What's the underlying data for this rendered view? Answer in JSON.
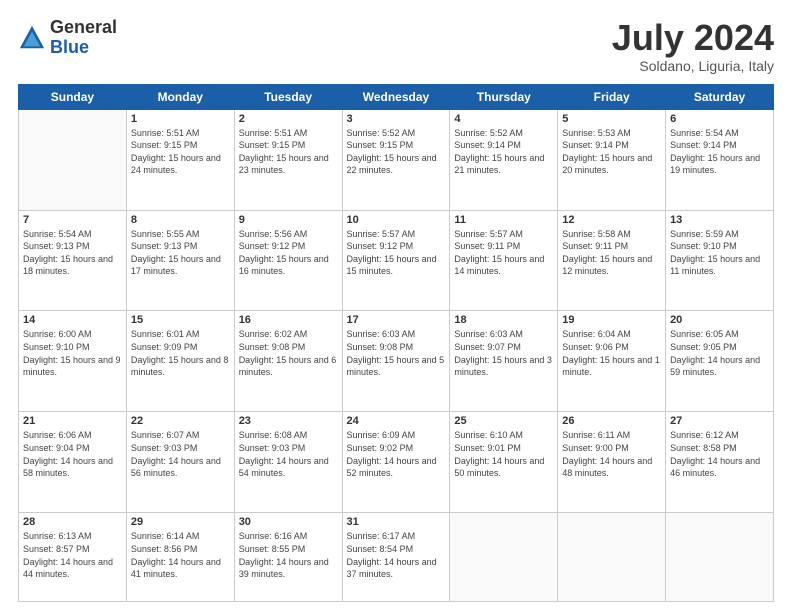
{
  "header": {
    "logo": {
      "general": "General",
      "blue": "Blue"
    },
    "title": "July 2024",
    "subtitle": "Soldano, Liguria, Italy"
  },
  "weekdays": [
    "Sunday",
    "Monday",
    "Tuesday",
    "Wednesday",
    "Thursday",
    "Friday",
    "Saturday"
  ],
  "weeks": [
    [
      {
        "day": null
      },
      {
        "day": 1,
        "sunrise": "Sunrise: 5:51 AM",
        "sunset": "Sunset: 9:15 PM",
        "daylight": "Daylight: 15 hours and 24 minutes."
      },
      {
        "day": 2,
        "sunrise": "Sunrise: 5:51 AM",
        "sunset": "Sunset: 9:15 PM",
        "daylight": "Daylight: 15 hours and 23 minutes."
      },
      {
        "day": 3,
        "sunrise": "Sunrise: 5:52 AM",
        "sunset": "Sunset: 9:15 PM",
        "daylight": "Daylight: 15 hours and 22 minutes."
      },
      {
        "day": 4,
        "sunrise": "Sunrise: 5:52 AM",
        "sunset": "Sunset: 9:14 PM",
        "daylight": "Daylight: 15 hours and 21 minutes."
      },
      {
        "day": 5,
        "sunrise": "Sunrise: 5:53 AM",
        "sunset": "Sunset: 9:14 PM",
        "daylight": "Daylight: 15 hours and 20 minutes."
      },
      {
        "day": 6,
        "sunrise": "Sunrise: 5:54 AM",
        "sunset": "Sunset: 9:14 PM",
        "daylight": "Daylight: 15 hours and 19 minutes."
      }
    ],
    [
      {
        "day": 7,
        "sunrise": "Sunrise: 5:54 AM",
        "sunset": "Sunset: 9:13 PM",
        "daylight": "Daylight: 15 hours and 18 minutes."
      },
      {
        "day": 8,
        "sunrise": "Sunrise: 5:55 AM",
        "sunset": "Sunset: 9:13 PM",
        "daylight": "Daylight: 15 hours and 17 minutes."
      },
      {
        "day": 9,
        "sunrise": "Sunrise: 5:56 AM",
        "sunset": "Sunset: 9:12 PM",
        "daylight": "Daylight: 15 hours and 16 minutes."
      },
      {
        "day": 10,
        "sunrise": "Sunrise: 5:57 AM",
        "sunset": "Sunset: 9:12 PM",
        "daylight": "Daylight: 15 hours and 15 minutes."
      },
      {
        "day": 11,
        "sunrise": "Sunrise: 5:57 AM",
        "sunset": "Sunset: 9:11 PM",
        "daylight": "Daylight: 15 hours and 14 minutes."
      },
      {
        "day": 12,
        "sunrise": "Sunrise: 5:58 AM",
        "sunset": "Sunset: 9:11 PM",
        "daylight": "Daylight: 15 hours and 12 minutes."
      },
      {
        "day": 13,
        "sunrise": "Sunrise: 5:59 AM",
        "sunset": "Sunset: 9:10 PM",
        "daylight": "Daylight: 15 hours and 11 minutes."
      }
    ],
    [
      {
        "day": 14,
        "sunrise": "Sunrise: 6:00 AM",
        "sunset": "Sunset: 9:10 PM",
        "daylight": "Daylight: 15 hours and 9 minutes."
      },
      {
        "day": 15,
        "sunrise": "Sunrise: 6:01 AM",
        "sunset": "Sunset: 9:09 PM",
        "daylight": "Daylight: 15 hours and 8 minutes."
      },
      {
        "day": 16,
        "sunrise": "Sunrise: 6:02 AM",
        "sunset": "Sunset: 9:08 PM",
        "daylight": "Daylight: 15 hours and 6 minutes."
      },
      {
        "day": 17,
        "sunrise": "Sunrise: 6:03 AM",
        "sunset": "Sunset: 9:08 PM",
        "daylight": "Daylight: 15 hours and 5 minutes."
      },
      {
        "day": 18,
        "sunrise": "Sunrise: 6:03 AM",
        "sunset": "Sunset: 9:07 PM",
        "daylight": "Daylight: 15 hours and 3 minutes."
      },
      {
        "day": 19,
        "sunrise": "Sunrise: 6:04 AM",
        "sunset": "Sunset: 9:06 PM",
        "daylight": "Daylight: 15 hours and 1 minute."
      },
      {
        "day": 20,
        "sunrise": "Sunrise: 6:05 AM",
        "sunset": "Sunset: 9:05 PM",
        "daylight": "Daylight: 14 hours and 59 minutes."
      }
    ],
    [
      {
        "day": 21,
        "sunrise": "Sunrise: 6:06 AM",
        "sunset": "Sunset: 9:04 PM",
        "daylight": "Daylight: 14 hours and 58 minutes."
      },
      {
        "day": 22,
        "sunrise": "Sunrise: 6:07 AM",
        "sunset": "Sunset: 9:03 PM",
        "daylight": "Daylight: 14 hours and 56 minutes."
      },
      {
        "day": 23,
        "sunrise": "Sunrise: 6:08 AM",
        "sunset": "Sunset: 9:03 PM",
        "daylight": "Daylight: 14 hours and 54 minutes."
      },
      {
        "day": 24,
        "sunrise": "Sunrise: 6:09 AM",
        "sunset": "Sunset: 9:02 PM",
        "daylight": "Daylight: 14 hours and 52 minutes."
      },
      {
        "day": 25,
        "sunrise": "Sunrise: 6:10 AM",
        "sunset": "Sunset: 9:01 PM",
        "daylight": "Daylight: 14 hours and 50 minutes."
      },
      {
        "day": 26,
        "sunrise": "Sunrise: 6:11 AM",
        "sunset": "Sunset: 9:00 PM",
        "daylight": "Daylight: 14 hours and 48 minutes."
      },
      {
        "day": 27,
        "sunrise": "Sunrise: 6:12 AM",
        "sunset": "Sunset: 8:58 PM",
        "daylight": "Daylight: 14 hours and 46 minutes."
      }
    ],
    [
      {
        "day": 28,
        "sunrise": "Sunrise: 6:13 AM",
        "sunset": "Sunset: 8:57 PM",
        "daylight": "Daylight: 14 hours and 44 minutes."
      },
      {
        "day": 29,
        "sunrise": "Sunrise: 6:14 AM",
        "sunset": "Sunset: 8:56 PM",
        "daylight": "Daylight: 14 hours and 41 minutes."
      },
      {
        "day": 30,
        "sunrise": "Sunrise: 6:16 AM",
        "sunset": "Sunset: 8:55 PM",
        "daylight": "Daylight: 14 hours and 39 minutes."
      },
      {
        "day": 31,
        "sunrise": "Sunrise: 6:17 AM",
        "sunset": "Sunset: 8:54 PM",
        "daylight": "Daylight: 14 hours and 37 minutes."
      },
      {
        "day": null
      },
      {
        "day": null
      },
      {
        "day": null
      }
    ]
  ]
}
